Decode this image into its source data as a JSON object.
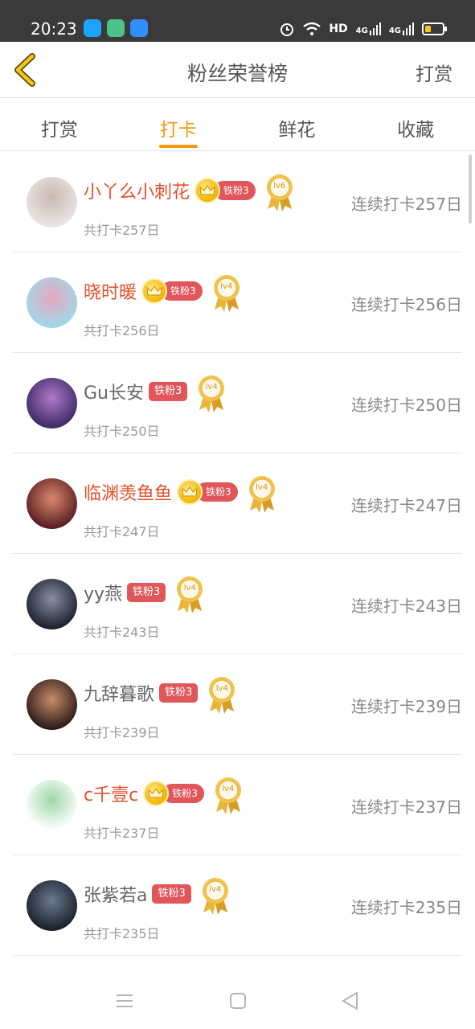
{
  "status_bar": {
    "time": "20:23",
    "network_label": "HD",
    "signal_1": "4G",
    "signal_2": "4G",
    "battery_level": 0.35,
    "apps": [
      {
        "name": "qq-icon",
        "color": "#1aa3ff"
      },
      {
        "name": "green-app-icon",
        "color": "#4cc38a"
      },
      {
        "name": "blue-app-icon",
        "color": "#2f8fff"
      }
    ]
  },
  "header": {
    "title": "粉丝荣誉榜",
    "action_label": "打赏",
    "back_icon": "chevron-left-icon",
    "accent": "#f5c518"
  },
  "tabs": [
    {
      "label": "打赏",
      "active": false
    },
    {
      "label": "打卡",
      "active": true
    },
    {
      "label": "鲜花",
      "active": false
    },
    {
      "label": "收藏",
      "active": false
    }
  ],
  "colors": {
    "accent": "#f29b0e",
    "vip_name": "#e2512b",
    "badge": "#e0565a",
    "medal": "#e8b838"
  },
  "fans": [
    {
      "name": "小丫么小刺花",
      "vip": true,
      "badge": "铁粉3",
      "level": "lv6",
      "total": "共打卡257日",
      "streak": "连续打卡257日",
      "avatar": [
        "#e9e6e4",
        "#c9b8b2"
      ]
    },
    {
      "name": "晓时暖",
      "vip": true,
      "badge": "铁粉3",
      "level": "lv4",
      "total": "共打卡256日",
      "streak": "连续打卡256日",
      "avatar": [
        "#9fd8e8",
        "#e8a7bf"
      ]
    },
    {
      "name": "Gu长安",
      "vip": false,
      "badge": "铁粉3",
      "level": "lv4",
      "total": "共打卡250日",
      "streak": "连续打卡250日",
      "avatar": [
        "#3b2a66",
        "#b07ac8"
      ]
    },
    {
      "name": "临渊羡鱼鱼",
      "vip": true,
      "badge": "铁粉3",
      "level": "lv4",
      "total": "共打卡247日",
      "streak": "连续打卡247日",
      "avatar": [
        "#5a1c22",
        "#d98a6a"
      ]
    },
    {
      "name": "yy燕",
      "vip": false,
      "badge": "铁粉3",
      "level": "lv4",
      "total": "共打卡243日",
      "streak": "连续打卡243日",
      "avatar": [
        "#1b1f2e",
        "#8a8fa3"
      ]
    },
    {
      "name": "九辞暮歌",
      "vip": false,
      "badge": "铁粉3",
      "level": "lv4",
      "total": "共打卡239日",
      "streak": "连续打卡239日",
      "avatar": [
        "#2a1a18",
        "#c98c6a"
      ]
    },
    {
      "name": "c千壹c",
      "vip": true,
      "badge": "铁粉3",
      "level": "lv4",
      "total": "共打卡237日",
      "streak": "连续打卡237日",
      "avatar": [
        "#ffffff",
        "#9fd6a8"
      ]
    },
    {
      "name": "张紫若a",
      "vip": false,
      "badge": "铁粉3",
      "level": "lv4",
      "total": "共打卡235日",
      "streak": "连续打卡235日",
      "avatar": [
        "#1a1f2a",
        "#6b7a90"
      ]
    }
  ],
  "nav": {
    "menu_icon": "menu-icon",
    "home_icon": "home-square-icon",
    "back_icon": "back-triangle-icon"
  }
}
